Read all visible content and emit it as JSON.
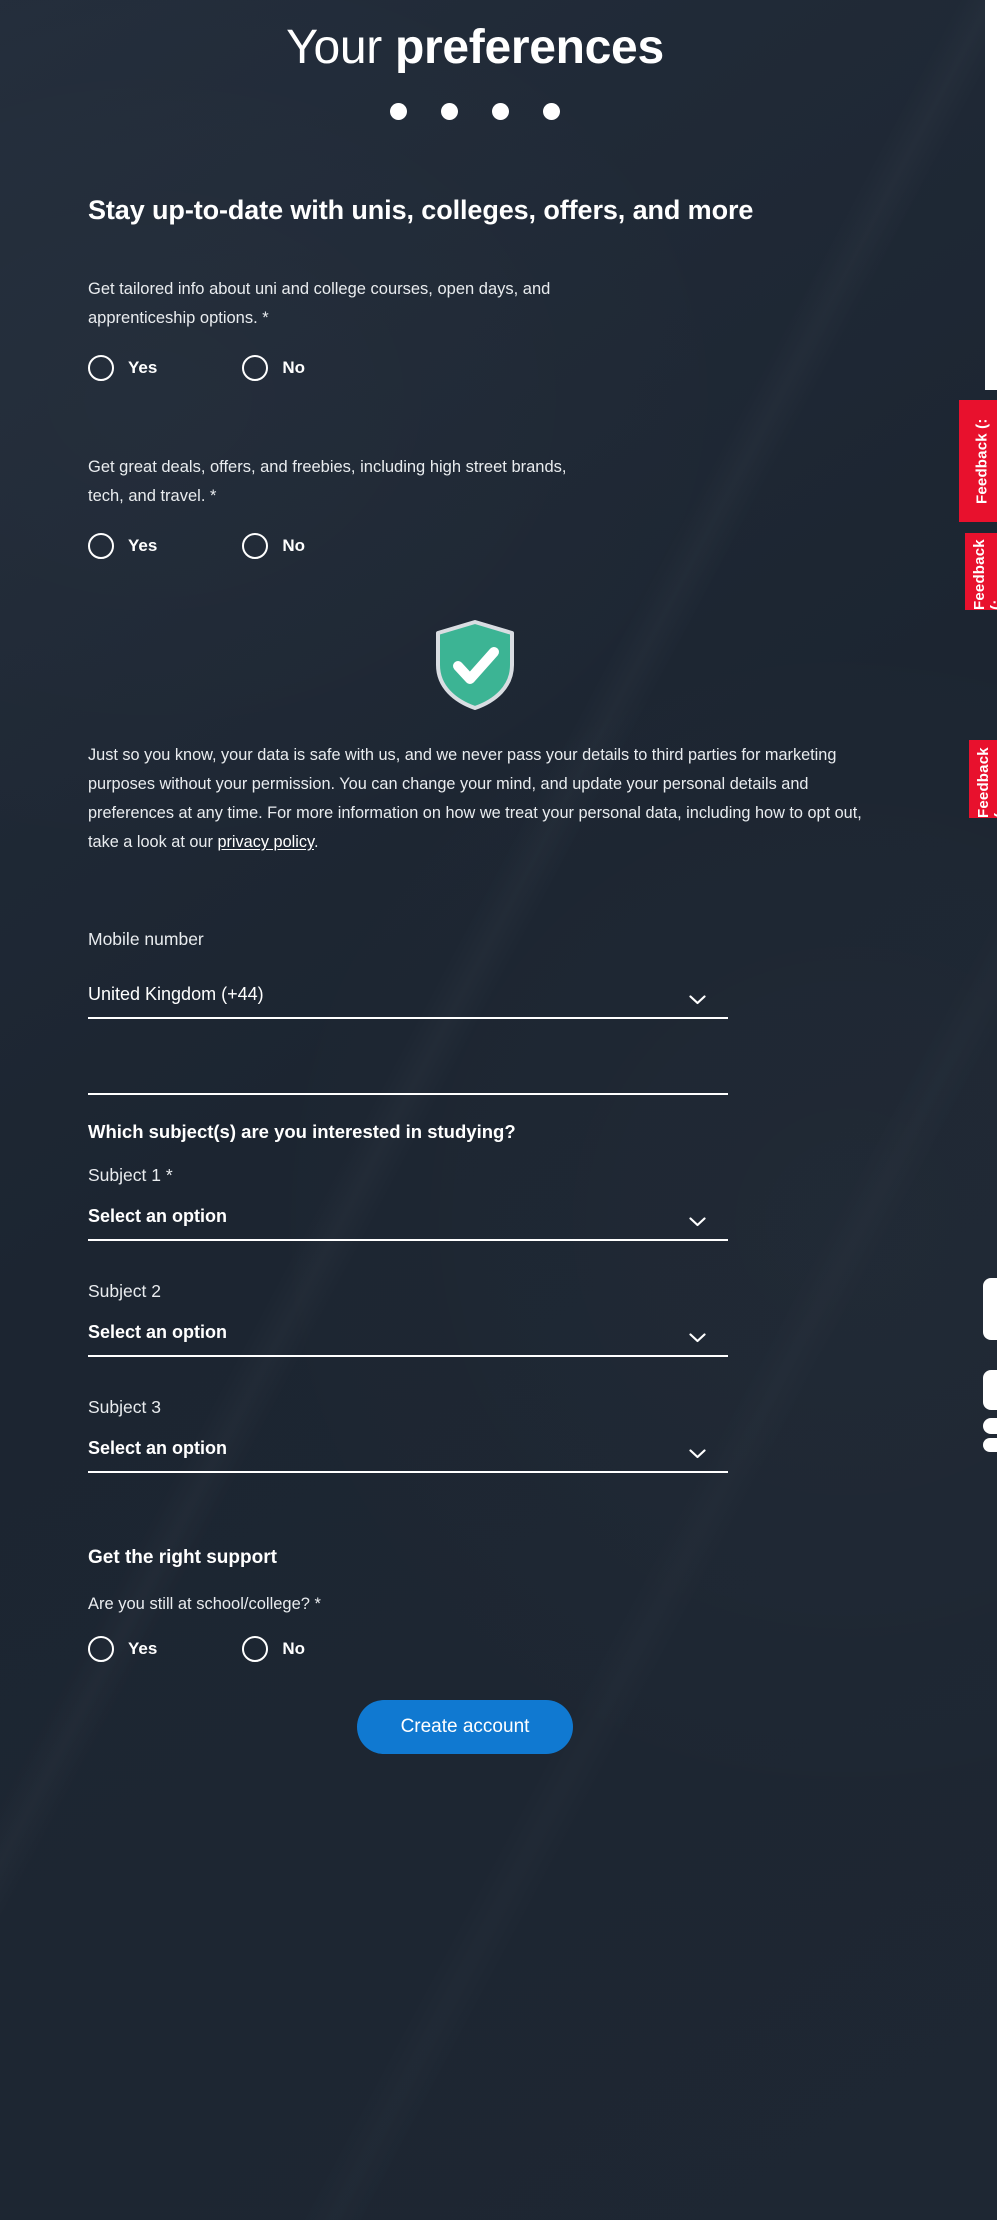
{
  "header": {
    "title_light": "Your ",
    "title_bold": "preferences",
    "progress_dots": 4
  },
  "marketing": {
    "heading": "Stay up-to-date with unis, colleges, offers, and more",
    "questions": [
      {
        "text": "Get tailored info about uni and college courses, open days, and apprenticeship options. *",
        "options": [
          "Yes",
          "No"
        ],
        "selected": null
      },
      {
        "text": "Get great deals, offers, and freebies, including high street brands, tech, and travel. *",
        "options": [
          "Yes",
          "No"
        ],
        "selected": null
      }
    ]
  },
  "assurance": {
    "icon": "shield-check-icon",
    "icon_color": "#3cb494",
    "text_before_link": "Just so you know, your data is safe with us, and we never pass your details to third parties for marketing purposes without your permission. You can change your mind, and update your personal details and preferences at any time. For more information on how we treat your personal data, including how to opt out, take a look at our ",
    "link_text": "privacy policy",
    "text_after_link": "."
  },
  "mobile": {
    "label": "Mobile number",
    "country_value": "United Kingdom (+44)",
    "number_value": "",
    "number_placeholder": ""
  },
  "subjects": {
    "title": "Which subject(s) are you interested in studying?",
    "items": [
      {
        "label": "Subject 1 *",
        "value": "Select an option"
      },
      {
        "label": "Subject 2",
        "value": "Select an option"
      },
      {
        "label": "Subject 3",
        "value": "Select an option"
      }
    ]
  },
  "support": {
    "title": "Get the right support",
    "question": "Are you still at school/college? *",
    "options": [
      "Yes",
      "No"
    ],
    "selected": null
  },
  "cta": {
    "label": "Create account",
    "color": "#1079d1"
  },
  "rail": {
    "feedback_tabs": [
      "Feedback (:",
      "Feedback (:",
      "Feedback (:"
    ],
    "tab_color": "#e8112d"
  },
  "theme": {
    "background": "#1e2733",
    "text": "#ffffff",
    "muted_text": "#e9ecef"
  }
}
